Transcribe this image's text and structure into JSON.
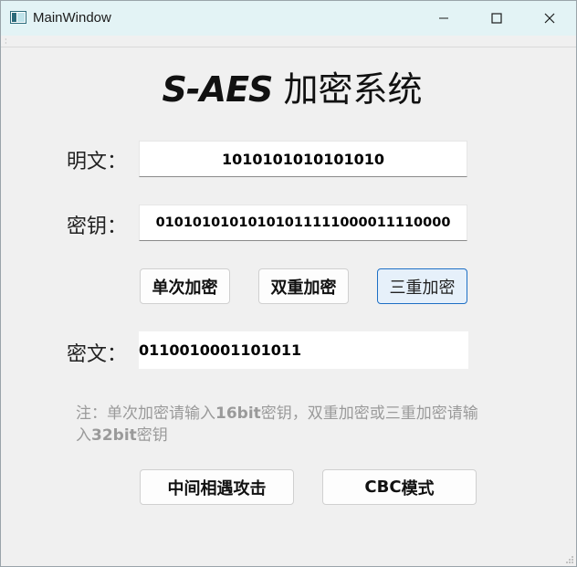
{
  "window": {
    "title": "MainWindow"
  },
  "header": {
    "brand": "S-AES",
    "title_rest": " 加密系统"
  },
  "plaintext": {
    "label": "明文：",
    "value": "1010101010101010"
  },
  "key": {
    "label": "密钥：",
    "value": "01010101010101011111000011110000"
  },
  "buttons": {
    "single": "单次加密",
    "double": "双重加密",
    "triple": "三重加密",
    "meet_in_middle": "中间相遇攻击",
    "cbc_prefix": "CBC",
    "cbc_suffix": " 模式"
  },
  "ciphertext": {
    "label": "密文：",
    "value": "0110010001101011"
  },
  "note": {
    "part1": "注：单次加密请输入",
    "bits16": "16bit",
    "part2": "密钥，双重加密或三重加密请输入",
    "bits32": "32bit",
    "part3": "密钥"
  },
  "colors": {
    "titlebar_bg": "#e3f3f5",
    "window_bg": "#f0f0f0",
    "active_border": "#1e6fc5",
    "note_text": "#9a9a9a"
  },
  "icons": {
    "app": "window-app-icon",
    "minimize": "minimize-icon",
    "maximize": "maximize-icon",
    "close": "close-icon"
  }
}
